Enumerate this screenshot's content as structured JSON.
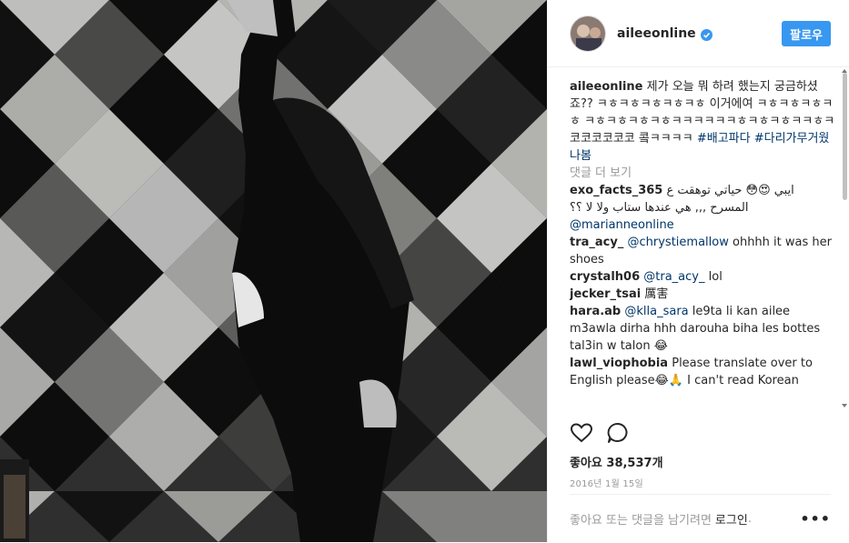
{
  "header": {
    "username": "aileeonline",
    "follow_label": "팔로우"
  },
  "caption": {
    "username": "aileeonline",
    "text": "제가 오늘 뭐 하려 했는지 궁금하셨죠?? ㅋㅎㅋㅎㅋㅎㅋㅎㅋㅎ 이거에여 ㅋㅎㅋㅎㅋㅎㅋㅎ ㅋㅎㅋㅎㅋㅎㅋㅎㅋㅋㅋㅋㅋㅋㅎㅋㅎㅋㅎㅋㅋㅎㅋ코코코코코코 콬ㅋㅋㅋㅋ",
    "tags": [
      "#배고파다",
      "#다리가무거웠나봄"
    ]
  },
  "load_more": "댓글 더 보기",
  "comments": [
    {
      "user": "exo_facts_365",
      "text_line1": "ايبي 😍😳 حياتي توهقت ع",
      "text_line2": "المسرح ,,, هي عندها ستاب ولا لا ؟؟",
      "mention": "@marianneonline"
    },
    {
      "user": "tra_acy_",
      "mention": "@chrystiemallow",
      "text": "ohhhh it was her shoes"
    },
    {
      "user": "crystalh06",
      "mention": "@tra_acy_",
      "text": "lol"
    },
    {
      "user": "jecker_tsai",
      "text": "厲害"
    },
    {
      "user": "hara.ab",
      "mention": "@klla_sara",
      "text": "le9ta li kan ailee m3awla dirha hhh darouha biha les bottes tal3in w talon 😂"
    },
    {
      "user": "lawl_viophobia",
      "text": "Please translate over to English please😂🙏 I can't read Korean"
    }
  ],
  "likes": "좋아요 38,537개",
  "date": "2016년 1월 15일",
  "login_prompt": "좋아요 또는 댓글을 남기려면",
  "login_link": "로그인",
  "login_suffix": ".",
  "icons": {
    "like": "heart-icon",
    "comment": "speech-bubble-icon",
    "verified": "verified-badge-icon",
    "more": "more-options-icon"
  },
  "colors": {
    "accent": "#3897f0",
    "hashtag": "#003569",
    "muted": "#999999"
  }
}
